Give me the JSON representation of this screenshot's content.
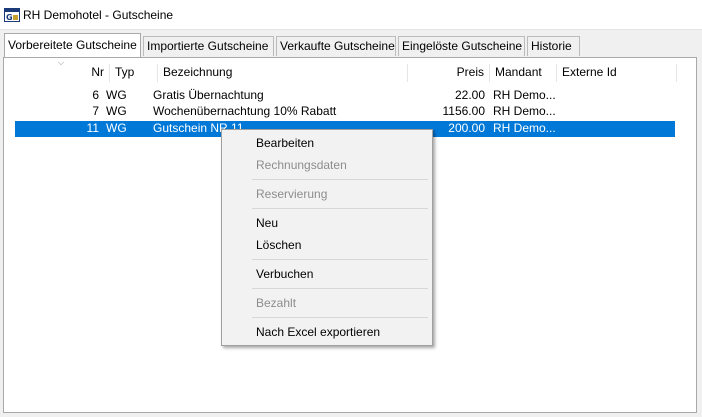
{
  "window": {
    "title": "RH Demohotel - Gutscheine"
  },
  "tabs": [
    {
      "label": "Vorbereitete Gutscheine",
      "active": true
    },
    {
      "label": "Importierte Gutscheine",
      "active": false
    },
    {
      "label": "Verkaufte Gutscheine",
      "active": false
    },
    {
      "label": "Eingelöste Gutscheine",
      "active": false
    },
    {
      "label": "Historie",
      "active": false
    }
  ],
  "table": {
    "columns": [
      "Nr",
      "Typ",
      "Bezeichnung",
      "Preis",
      "Mandant",
      "Externe Id"
    ],
    "rows": [
      {
        "nr": "6",
        "typ": "WG",
        "bezeichnung": "Gratis Übernachtung",
        "preis": "22.00",
        "mandant": "RH Demo...",
        "externe_id": "",
        "selected": false
      },
      {
        "nr": "7",
        "typ": "WG",
        "bezeichnung": "Wochenübernachtung 10% Rabatt",
        "preis": "1156.00",
        "mandant": "RH Demo...",
        "externe_id": "",
        "selected": false
      },
      {
        "nr": "11",
        "typ": "WG",
        "bezeichnung": "Gutschein NR 11",
        "preis": "200.00",
        "mandant": "RH Demo...",
        "externe_id": "",
        "selected": true
      }
    ]
  },
  "context_menu": {
    "items": [
      {
        "label": "Bearbeiten",
        "enabled": true
      },
      {
        "label": "Rechnungsdaten",
        "enabled": false
      },
      {
        "label": "Reservierung",
        "enabled": false
      },
      {
        "label": "Neu",
        "enabled": true
      },
      {
        "label": "Löschen",
        "enabled": true
      },
      {
        "label": "Verbuchen",
        "enabled": true
      },
      {
        "label": "Bezahlt",
        "enabled": false
      },
      {
        "label": "Nach Excel exportieren",
        "enabled": true
      }
    ]
  },
  "colors": {
    "selection": "#0078d7",
    "disabled_text": "#8d8d8d"
  }
}
